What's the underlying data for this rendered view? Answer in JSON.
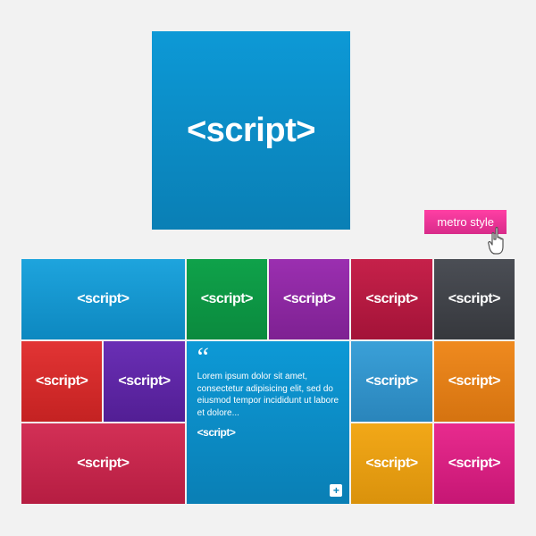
{
  "hero": {
    "label": "<script>"
  },
  "metro": {
    "label": "metro style"
  },
  "text_tile": {
    "quote": "“",
    "lorem": "Lorem ipsum dolor sit amet, consectetur adipisicing elit, sed do eiusmod tempor incididunt ut labore et dolore...",
    "label": "<script>",
    "plus": "+"
  },
  "tiles": {
    "t1": "<script>",
    "t2": "<script>",
    "t3": "<script>",
    "t4": "<script>",
    "t5": "<script>",
    "t6": "<script>",
    "t7": "<script>",
    "t9": "<script>",
    "t10": "<script>",
    "t11": "<script>",
    "t12": "<script>",
    "t13": "<script>"
  }
}
